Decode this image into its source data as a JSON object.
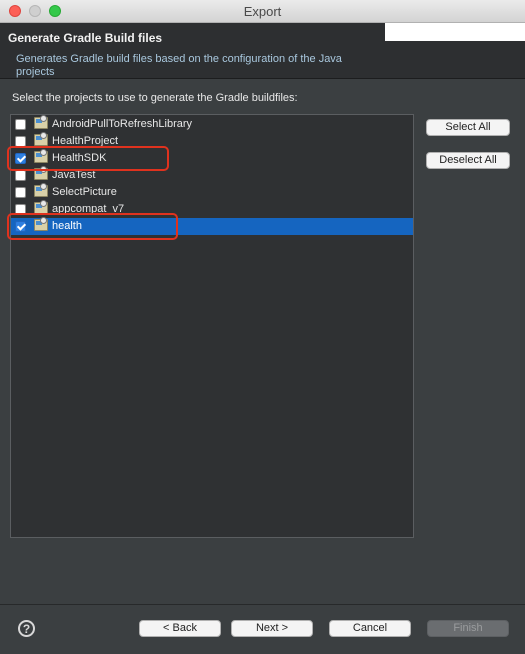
{
  "window": {
    "title": "Export"
  },
  "header": {
    "title": "Generate Gradle Build files",
    "description": "Generates Gradle build files based on the configuration of the Java projects"
  },
  "instruction": "Select the projects to use to generate the Gradle buildfiles:",
  "projects": [
    {
      "name": "AndroidPullToRefreshLibrary",
      "checked": false,
      "selected": false
    },
    {
      "name": "HealthProject",
      "checked": false,
      "selected": false
    },
    {
      "name": "HealthSDK",
      "checked": true,
      "selected": false
    },
    {
      "name": "JavaTest",
      "checked": false,
      "selected": false
    },
    {
      "name": "SelectPicture",
      "checked": false,
      "selected": false
    },
    {
      "name": "appcompat_v7",
      "checked": false,
      "selected": false
    },
    {
      "name": "health",
      "checked": true,
      "selected": true
    }
  ],
  "side_buttons": {
    "select_all": "Select All",
    "deselect_all": "Deselect All"
  },
  "footer": {
    "help_glyph": "?",
    "back": "< Back",
    "next": "Next >",
    "cancel": "Cancel",
    "finish": "Finish"
  },
  "colors": {
    "selection": "#1565c0",
    "annotation": "#e0321e"
  }
}
